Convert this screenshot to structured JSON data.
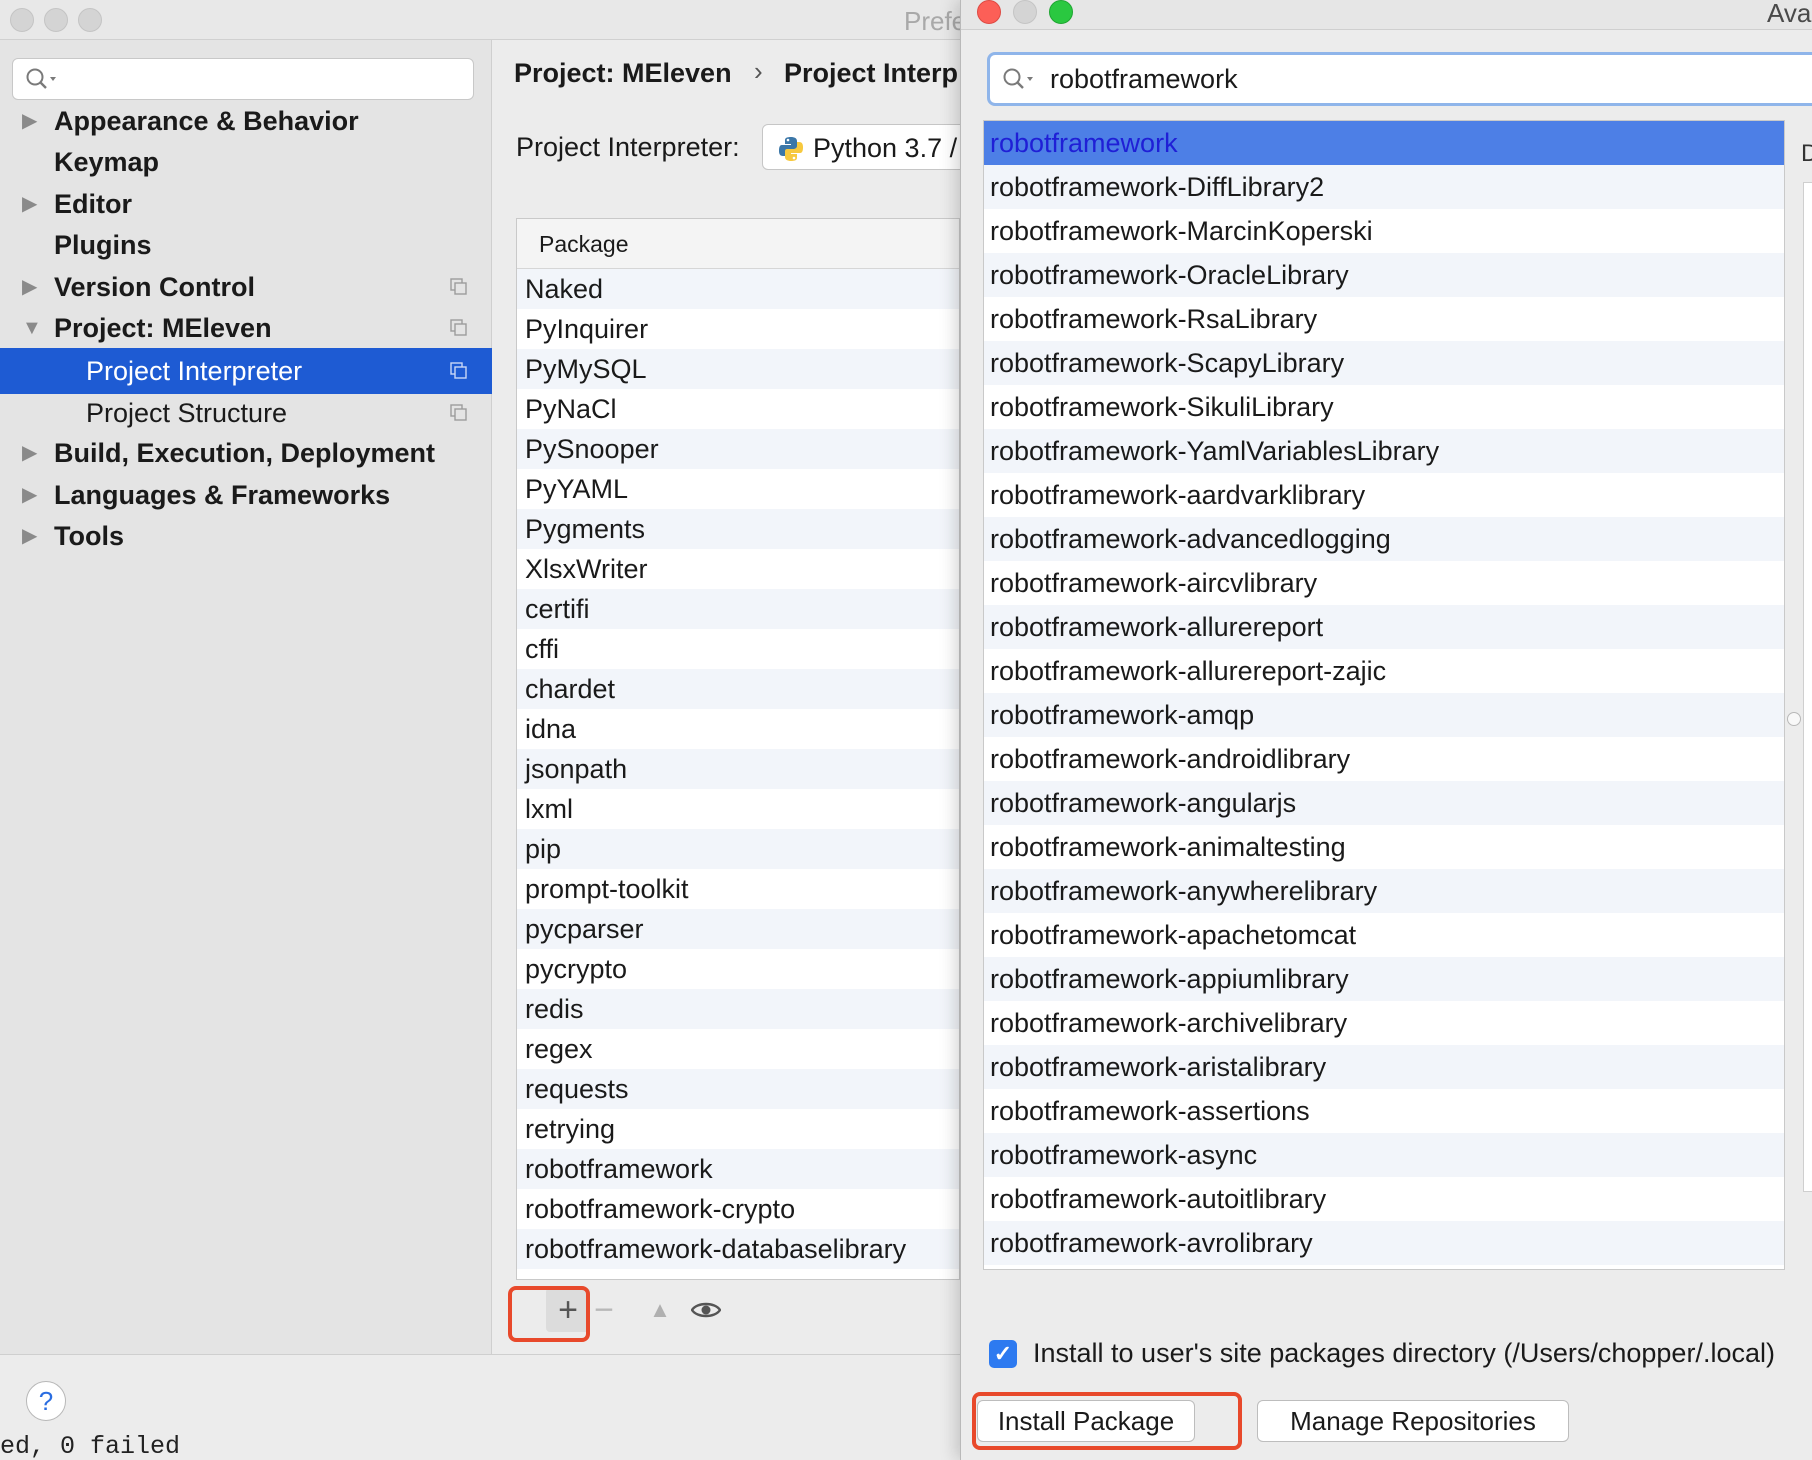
{
  "preferences": {
    "title": "Prefe",
    "sidebar": {
      "items": [
        {
          "label": "Appearance & Behavior",
          "arrow": "▶"
        },
        {
          "label": "Keymap",
          "arrow": ""
        },
        {
          "label": "Editor",
          "arrow": "▶"
        },
        {
          "label": "Plugins",
          "arrow": ""
        },
        {
          "label": "Version Control",
          "arrow": "▶"
        },
        {
          "label": "Project: MEleven",
          "arrow": "▼"
        },
        {
          "label": "Project Interpreter",
          "arrow": ""
        },
        {
          "label": "Project Structure",
          "arrow": ""
        },
        {
          "label": "Build, Execution, Deployment",
          "arrow": "▶"
        },
        {
          "label": "Languages & Frameworks",
          "arrow": "▶"
        },
        {
          "label": "Tools",
          "arrow": "▶"
        }
      ]
    },
    "breadcrumb": {
      "project": "Project: MEleven",
      "separator": "›",
      "page": "Project Interp"
    },
    "interpreter": {
      "label": "Project Interpreter:",
      "value": "Python 3.7 /"
    },
    "packages": {
      "column_header": "Package",
      "rows": [
        "Naked",
        "PyInquirer",
        "PyMySQL",
        "PyNaCl",
        "PySnooper",
        "PyYAML",
        "Pygments",
        "XlsxWriter",
        "certifi",
        "cffi",
        "chardet",
        "idna",
        "jsonpath",
        "lxml",
        "pip",
        "prompt-toolkit",
        "pycparser",
        "pycrypto",
        "redis",
        "regex",
        "requests",
        "retrying",
        "robotframework",
        "robotframework-crypto",
        "robotframework-databaselibrary"
      ]
    },
    "toolbar": {
      "add": "+",
      "remove": "−",
      "upgrade": "▲",
      "show": "eye-icon"
    },
    "help": "?",
    "console_text": "ed, 0 failed"
  },
  "dialog": {
    "title": "Avai",
    "search_value": "robotframework",
    "selected_index": 0,
    "results": [
      "robotframework",
      "robotframework-DiffLibrary2",
      "robotframework-MarcinKoperski",
      "robotframework-OracleLibrary",
      "robotframework-RsaLibrary",
      "robotframework-ScapyLibrary",
      "robotframework-SikuliLibrary",
      "robotframework-YamlVariablesLibrary",
      "robotframework-aardvarklibrary",
      "robotframework-advancedlogging",
      "robotframework-aircvlibrary",
      "robotframework-allurereport",
      "robotframework-allurereport-zajic",
      "robotframework-amqp",
      "robotframework-androidlibrary",
      "robotframework-angularjs",
      "robotframework-animaltesting",
      "robotframework-anywherelibrary",
      "robotframework-apachetomcat",
      "robotframework-appiumlibrary",
      "robotframework-archivelibrary",
      "robotframework-aristalibrary",
      "robotframework-assertions",
      "robotframework-async",
      "robotframework-autoitlibrary",
      "robotframework-avrolibrary"
    ],
    "description_edge": "D",
    "install_to_user_checked": true,
    "install_to_user_label": "Install to user's site packages directory (/Users/chopper/.local)",
    "install_button": "Install Package",
    "manage_button": "Manage Repositories"
  },
  "colors": {
    "selection": "#1e5bd3",
    "list_selection": "#4d7fe6",
    "highlight": "#e8492b",
    "checkbox": "#2d7af0"
  }
}
